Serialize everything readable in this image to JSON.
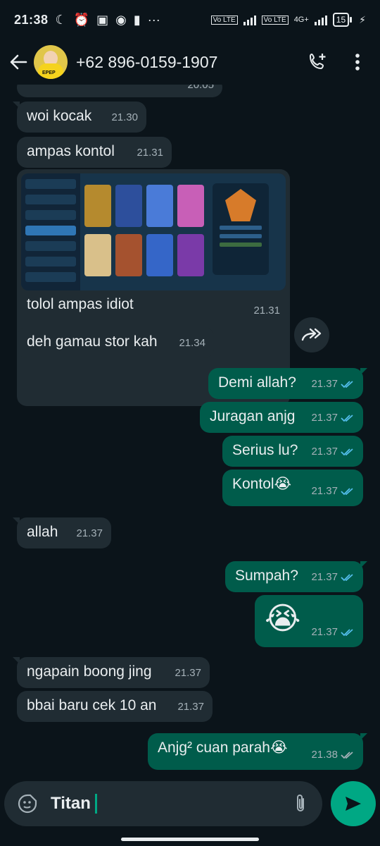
{
  "status": {
    "time": "21:38",
    "network_label": "4G+",
    "battery": "15"
  },
  "header": {
    "contact": "+62 896-0159-1907",
    "avatar_text": "EPEP"
  },
  "messages": [
    {
      "text": "woi kocak",
      "time": "21.30",
      "dir": "in"
    },
    {
      "text": "ampas kontol",
      "time": "21.31",
      "dir": "in"
    },
    {
      "text": "tolol ampas idiot",
      "time": "21.31",
      "dir": "in"
    },
    {
      "text": "deh gamau stor kah",
      "time": "21.34",
      "dir": "in"
    },
    {
      "text": "Demi allah?",
      "time": "21.37",
      "dir": "out"
    },
    {
      "text": "Juragan anjg",
      "time": "21.37",
      "dir": "out"
    },
    {
      "text": "Serius lu?",
      "time": "21.37",
      "dir": "out"
    },
    {
      "text": "Kontol😭",
      "time": "21.37",
      "dir": "out"
    },
    {
      "text": "allah",
      "time": "21.37",
      "dir": "in"
    },
    {
      "text": "Sumpah?",
      "time": "21.37",
      "dir": "out"
    },
    {
      "text": "😭",
      "time": "21.37",
      "dir": "out"
    },
    {
      "text": "ngapain boong jing",
      "time": "21.37",
      "dir": "in"
    },
    {
      "text": "bbai baru cek 10 an",
      "time": "21.37",
      "dir": "in"
    },
    {
      "text": "Anjg² cuan parah😭",
      "time": "21.38",
      "dir": "out"
    }
  ],
  "partial_prev_time": "20.05",
  "image_caption_time": "21.31",
  "input": {
    "value": "Titan"
  },
  "colors": {
    "bg": "#0b141a",
    "incoming": "#202c33",
    "outgoing": "#005c4b",
    "accent": "#00a884",
    "read_ticks": "#53bdeb",
    "sent_ticks": "#a5b1b8"
  }
}
